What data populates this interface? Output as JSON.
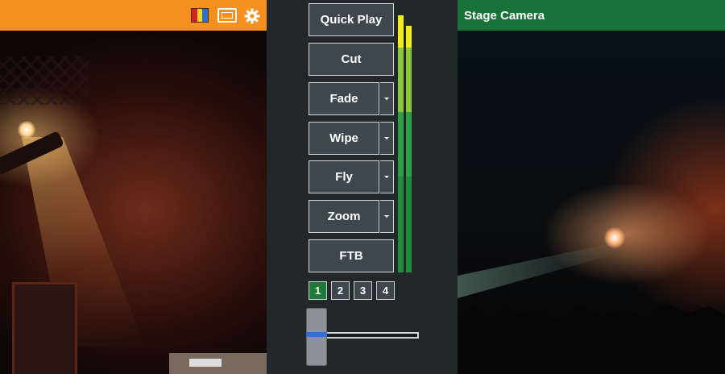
{
  "preview": {
    "bar_color": "#f4901e",
    "icons": [
      "color-bars-icon",
      "safe-area-icon",
      "gear-icon"
    ]
  },
  "program": {
    "title": "Stage Camera",
    "bar_color": "#197239"
  },
  "transitions": {
    "buttons": [
      {
        "label": "Quick Play",
        "has_dropdown": false
      },
      {
        "label": "Cut",
        "has_dropdown": false
      },
      {
        "label": "Fade",
        "has_dropdown": true
      },
      {
        "label": "Wipe",
        "has_dropdown": true
      },
      {
        "label": "Fly",
        "has_dropdown": true
      },
      {
        "label": "Zoom",
        "has_dropdown": true
      },
      {
        "label": "FTB",
        "has_dropdown": false
      }
    ]
  },
  "pages": {
    "items": [
      "1",
      "2",
      "3",
      "4"
    ],
    "active": "1",
    "active_color": "#1f7a3a"
  },
  "audio_meter": {
    "colors": {
      "peak": "#f2ec1a",
      "high": "#8cc63f",
      "mid": "#2ea043",
      "low": "#238b3a"
    }
  },
  "tbar": {
    "position": 0
  }
}
